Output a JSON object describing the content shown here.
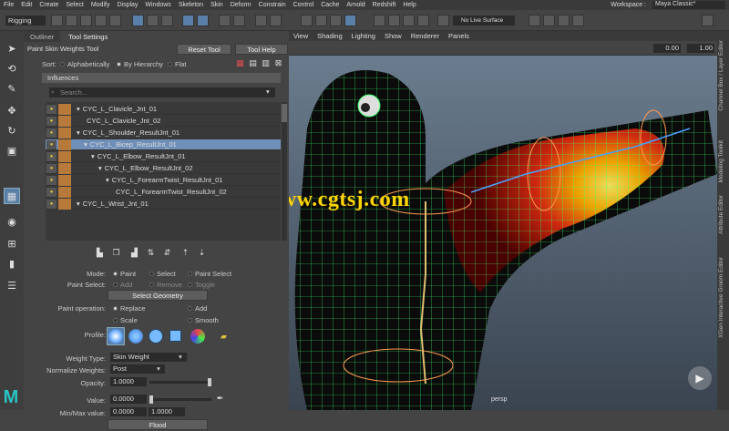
{
  "menubar": {
    "items": [
      "File",
      "Edit",
      "Create",
      "Select",
      "Modify",
      "Display",
      "Windows",
      "Skeleton",
      "Skin",
      "Deform",
      "Constrain",
      "Control",
      "Cache",
      "Arnold",
      "Redshift",
      "Help"
    ],
    "workspace_label": "Workspace :",
    "workspace_value": "Maya Classic*"
  },
  "shelf": {
    "mode": "Rigging",
    "live_surface": "No Live Surface"
  },
  "tabs": [
    "Outliner",
    "Tool Settings"
  ],
  "tool": {
    "title": "Paint Skin Weights Tool",
    "reset": "Reset Tool",
    "help": "Tool Help"
  },
  "sort": {
    "label": "Sort:",
    "options": [
      "Alphabetically",
      "By Hierarchy",
      "Flat"
    ]
  },
  "influences": {
    "header": "Influences",
    "search_placeholder": "Search...",
    "rows": [
      {
        "name": "CYC_L_Clavicle_Jnt_01",
        "indent": 0,
        "arrow": "▾"
      },
      {
        "name": "CYC_L_Clavicle_Jnt_02",
        "indent": 1,
        "arrow": ""
      },
      {
        "name": "CYC_L_Shoulder_ResultJnt_01",
        "indent": 0,
        "arrow": "▾"
      },
      {
        "name": "CYC_L_Bicep_ResultJnt_01",
        "indent": 1,
        "arrow": "▾"
      },
      {
        "name": "CYC_L_Elbow_ResultJnt_01",
        "indent": 2,
        "arrow": "▾"
      },
      {
        "name": "CYC_L_Elbow_ResultJnt_02",
        "indent": 3,
        "arrow": "▾"
      },
      {
        "name": "CYC_L_ForearmTwist_ResultJnt_01",
        "indent": 4,
        "arrow": "▾"
      },
      {
        "name": "CYC_L_ForearmTwist_ResultJnt_02",
        "indent": 5,
        "arrow": ""
      },
      {
        "name": "CYC_L_Wrist_Jnt_01",
        "indent": 0,
        "arrow": "▾"
      }
    ],
    "selected_index": 3
  },
  "mode": {
    "label": "Mode:",
    "options": [
      "Paint",
      "Select",
      "Paint Select"
    ]
  },
  "paint_select": {
    "label": "Paint Select:",
    "options": [
      "Add",
      "Remove",
      "Toggle"
    ]
  },
  "select_geometry": "Select Geometry",
  "paint_operation": {
    "label": "Paint operation:",
    "options": [
      "Replace",
      "Add",
      "Scale",
      "Smooth"
    ]
  },
  "profile_label": "Profile:",
  "weight_type": {
    "label": "Weight Type:",
    "value": "Skin Weight"
  },
  "normalize": {
    "label": "Normalize Weights:",
    "value": "Post"
  },
  "opacity": {
    "label": "Opacity:",
    "value": "1.0000",
    "level": 1.0
  },
  "value": {
    "label": "Value:",
    "value": "0.0000",
    "level": 0.0
  },
  "minmax": {
    "label": "Min/Max value:",
    "min": "0.0000",
    "max": "1.0000"
  },
  "flood": "Flood",
  "viewport": {
    "menu": [
      "View",
      "Shading",
      "Lighting",
      "Show",
      "Renderer",
      "Panels"
    ],
    "field1": "0.00",
    "field2": "1.00",
    "watermark": "www.cgtsj.com",
    "persp": "persp"
  },
  "right_strip": [
    "Channel Box / Layer Editor",
    "Modeling Toolkit",
    "Attribute Editor",
    "XGen Interactive Groom Editor"
  ]
}
